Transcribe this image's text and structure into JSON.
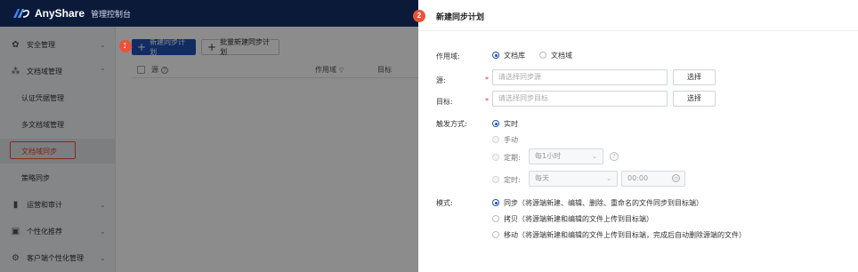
{
  "header": {
    "app_name": "AnyShare",
    "console_title": "管理控制台"
  },
  "sidebar": {
    "groups": [
      {
        "label": "安全管理",
        "icon": "gear-icon"
      },
      {
        "label": "文档域管理",
        "icon": "cluster-icon"
      },
      {
        "label": "运营和审计",
        "icon": "bar-chart-icon"
      },
      {
        "label": "个性化推荐",
        "icon": "recommend-icon"
      },
      {
        "label": "客户端个性化管理",
        "icon": "settings-icon"
      }
    ],
    "subitems": [
      "认证凭据管理",
      "多文档域管理",
      "文档域同步",
      "策略同步"
    ],
    "active_subitem": "文档域同步"
  },
  "main": {
    "new_plan_button": "新建同步计划",
    "batch_new_button": "批量新建同步计划",
    "columns": [
      "源",
      "作用域",
      "目标"
    ]
  },
  "badges": {
    "step1": "1",
    "step2": "2"
  },
  "drawer": {
    "title": "新建同步计划",
    "scope": {
      "label": "作用域:",
      "options": [
        "文档库",
        "文档域"
      ],
      "selected": "文档库"
    },
    "source": {
      "label": "源:",
      "placeholder": "请选择同步源",
      "button": "选择"
    },
    "target": {
      "label": "目标:",
      "placeholder": "请选择同步目标",
      "button": "选择"
    },
    "trigger": {
      "label": "触发方式:",
      "options": [
        "实时",
        "手动",
        "定期:",
        "定时:"
      ],
      "selected": "实时",
      "periodic_value": "每1小时",
      "timed_value": "每天",
      "time_value": "00:00"
    },
    "mode": {
      "label": "模式:",
      "options": [
        "同步（将源端新建、编辑、删除、重命名的文件同步到目标端）",
        "拷贝（将源端新建和编辑的文件上传到目标端）",
        "移动（将源端新建和编辑的文件上传到目标端，完成后自动删除源端的文件）"
      ],
      "selected": 0
    }
  },
  "colors": {
    "header_bg": "#0c1a3a",
    "primary": "#1f4fb4",
    "badge": "#e8543a",
    "active_text": "#d94a2b"
  }
}
